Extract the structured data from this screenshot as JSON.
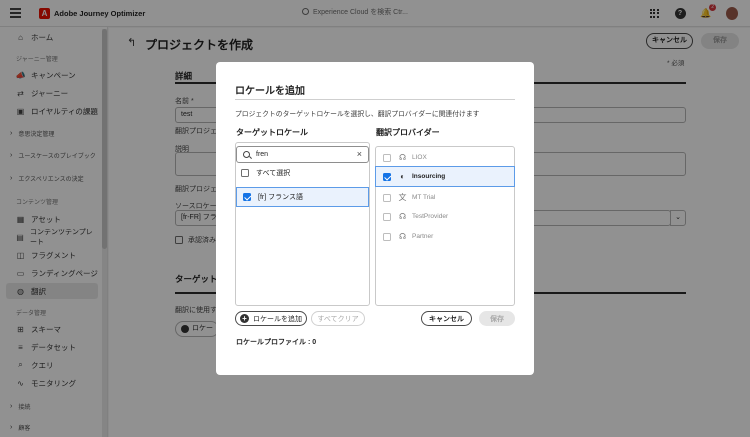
{
  "topbar": {
    "app_title": "Adobe Journey Optimizer",
    "search_placeholder": "Experience Cloud を検索 Ctr...",
    "notification_count": "2"
  },
  "sidebar": {
    "items": [
      {
        "label": "ホーム",
        "icon": "home-icon"
      },
      {
        "label": "キャンペーン",
        "icon": "megaphone-icon"
      },
      {
        "label": "ジャーニー",
        "icon": "journey-icon"
      },
      {
        "label": "ロイヤルティの課題",
        "icon": "loyalty-icon"
      },
      {
        "label": "アセット",
        "icon": "asset-icon"
      },
      {
        "label": "コンテンツテンプレート",
        "icon": "template-icon"
      },
      {
        "label": "フラグメント",
        "icon": "fragment-icon"
      },
      {
        "label": "ランディングページ",
        "icon": "landing-page-icon"
      },
      {
        "label": "翻訳",
        "icon": "globe-icon"
      },
      {
        "label": "スキーマ",
        "icon": "schema-icon"
      },
      {
        "label": "データセット",
        "icon": "dataset-icon"
      },
      {
        "label": "クエリ",
        "icon": "query-icon"
      },
      {
        "label": "モニタリング",
        "icon": "monitoring-icon"
      }
    ],
    "sections": [
      "ジャーニー管理",
      "コンテンツ管理",
      "データ管理"
    ],
    "groups": [
      "意思決定管理",
      "ユースケースのプレイブック",
      "エクスペリエンスの決定",
      "接続",
      "顧客"
    ]
  },
  "page": {
    "title": "プロジェクトを作成",
    "cancel_label": "キャンセル",
    "save_label": "保存",
    "required_note": "* 必須",
    "details_heading": "詳細",
    "name_label": "名前 *",
    "name_value": "test",
    "project_hint_1": "翻訳プロジェ",
    "description_label": "説明",
    "project_hint_2": "翻訳プロジェク",
    "source_locale_label": "ソースロケール",
    "source_locale_value": "[fr-FR] フラン",
    "approval_label": "承認済み",
    "target_heading": "ターゲット",
    "target_hint": "翻訳に使用す",
    "add_locale_partial": "ロケー"
  },
  "modal": {
    "title": "ロケールを追加",
    "description": "プロジェクトのターゲットロケールを選択し、翻訳プロバイダーに関連付けます",
    "target_locale_title": "ターゲットロケール",
    "provider_title": "翻訳プロバイダー",
    "search_value": "fren",
    "select_all_label": "すべて選択",
    "locales": [
      {
        "label": "[fr] フランス語",
        "checked": true
      }
    ],
    "providers": [
      {
        "label": "LIOX",
        "checked": false,
        "icon": "headset-icon"
      },
      {
        "label": "Insourcing",
        "checked": true,
        "icon": "insourcing-icon"
      },
      {
        "label": "MT Trial",
        "checked": false,
        "icon": "machine-translate-icon"
      },
      {
        "label": "TestProvider",
        "checked": false,
        "icon": "headset-icon"
      },
      {
        "label": "Partner",
        "checked": false,
        "icon": "headset-icon"
      }
    ],
    "add_locale_label": "ロケールを追加",
    "clear_all_label": "すべてクリア",
    "cancel_label": "キャンセル",
    "save_label": "保存",
    "profile_label": "ロケールプロファイル : 0"
  }
}
